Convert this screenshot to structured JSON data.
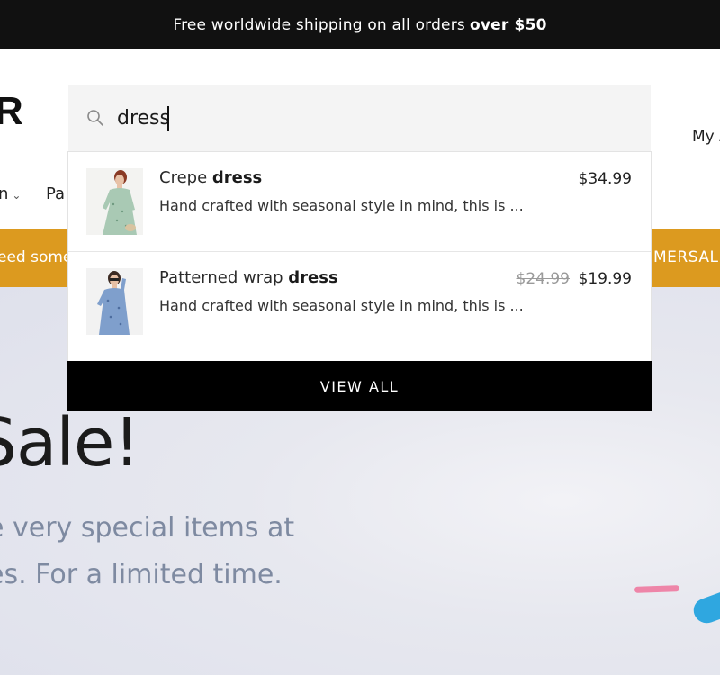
{
  "announcement": {
    "text": "Free worldwide shipping on all orders",
    "bold": "over $50"
  },
  "header": {
    "logo_fragment": "R",
    "account_fragment": "My A",
    "nav": [
      {
        "label": "n"
      },
      {
        "label": "Pa"
      }
    ]
  },
  "promo": {
    "left_fragment": "eed some",
    "right_fragment": "MERSALE"
  },
  "search": {
    "value": "dress",
    "placeholder": ""
  },
  "results": [
    {
      "title_plain": "Crepe ",
      "title_match": "dress",
      "description": "Hand crafted with seasonal style in mind, this is ...",
      "price": "$34.99",
      "compare_price": ""
    },
    {
      "title_plain": "Patterned wrap ",
      "title_match": "dress",
      "description": "Hand crafted with seasonal style in mind, this is ...",
      "price": "$19.99",
      "compare_price": "$24.99"
    }
  ],
  "view_all_label": "VIEW ALL",
  "hero": {
    "title": "Sale!",
    "line1": "e very special items at",
    "line2": "es. For a limited time."
  },
  "colors": {
    "announcement_bg": "#111111",
    "promo_bg": "#dc9a1f",
    "view_all_bg": "#000000",
    "hero_text": "#7e8aa1"
  }
}
